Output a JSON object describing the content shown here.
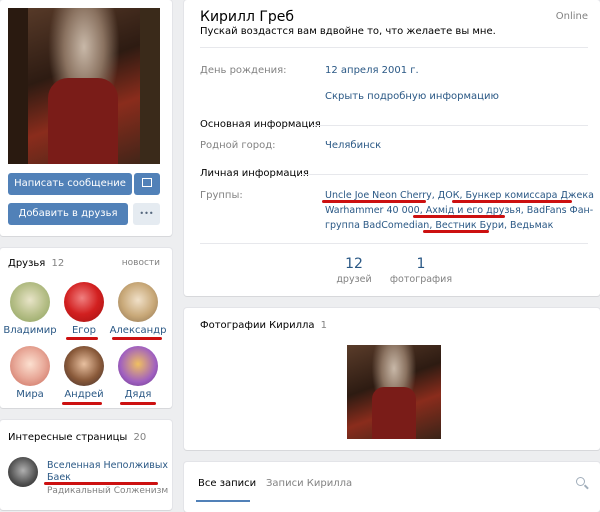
{
  "profile": {
    "name": "Кирилл Греб",
    "status_line": "Пускай воздастся вам вдвойне то, что желаете вы мне.",
    "online": "Online",
    "birthday_label": "День рождения:",
    "birthday_value": "12 апреля 2001 г.",
    "hide_info": "Скрыть подробную информацию",
    "main_info_title": "Основная информация",
    "hometown_label": "Родной город:",
    "hometown_value": "Челябинск",
    "personal_info_title": "Личная информация",
    "groups_label": "Группы:",
    "groups": [
      "Uncle Joe Neon Cherry",
      "ДОК",
      "Бункер комиссара Джека",
      "Warhammer 40 000",
      "Ахмід и его друзья",
      "BadFans Фан-группа BadComedian",
      "Вестник Бури",
      "Ведьмак"
    ],
    "groups_line1": {
      "a": "Uncle Joe Neon Cherry",
      "sep1": ", ",
      "b": "ДОК",
      "sep2": ", ",
      "c": "Бункер комиссара Джека"
    },
    "groups_line2": {
      "a": "Warhammer 40 000",
      "sep1": ", ",
      "b": "Ахмід и его друзья",
      "sep2": ", ",
      "c": "BadFans Фан-"
    },
    "groups_line3": {
      "a": "группа BadComedian",
      "sep1": ", ",
      "b": "Вестник Бури",
      "sep2": ", ",
      "c": "Ведьмак"
    }
  },
  "counters": [
    {
      "number": "12",
      "label": "друзей"
    },
    {
      "number": "1",
      "label": "фотография"
    }
  ],
  "actions": {
    "message": "Написать сообщение",
    "add_friend": "Добавить в друзья",
    "more": "•••",
    "gift_icon": "gift-icon"
  },
  "friends": {
    "title": "Друзья",
    "count": "12",
    "news": "новости",
    "items": [
      {
        "name": "Владимир"
      },
      {
        "name": "Егор"
      },
      {
        "name": "Александр"
      },
      {
        "name": "Мира"
      },
      {
        "name": "Андрей"
      },
      {
        "name": "Дядя"
      }
    ]
  },
  "interesting": {
    "title": "Интересные страницы",
    "count": "20",
    "page_name_l1": "Вселенная Неполживых",
    "page_name_l2": "Баек",
    "page_sub": "Радикальный Солженизм"
  },
  "photos": {
    "title": "Фотографии Кирилла",
    "count": "1"
  },
  "wall": {
    "tab_all": "Все записи",
    "tab_own": "Записи Кирилла"
  },
  "colors": {
    "accent": "#5181b8",
    "link": "#2a5885",
    "underline": "#cc1010",
    "background": "#edeef0"
  }
}
